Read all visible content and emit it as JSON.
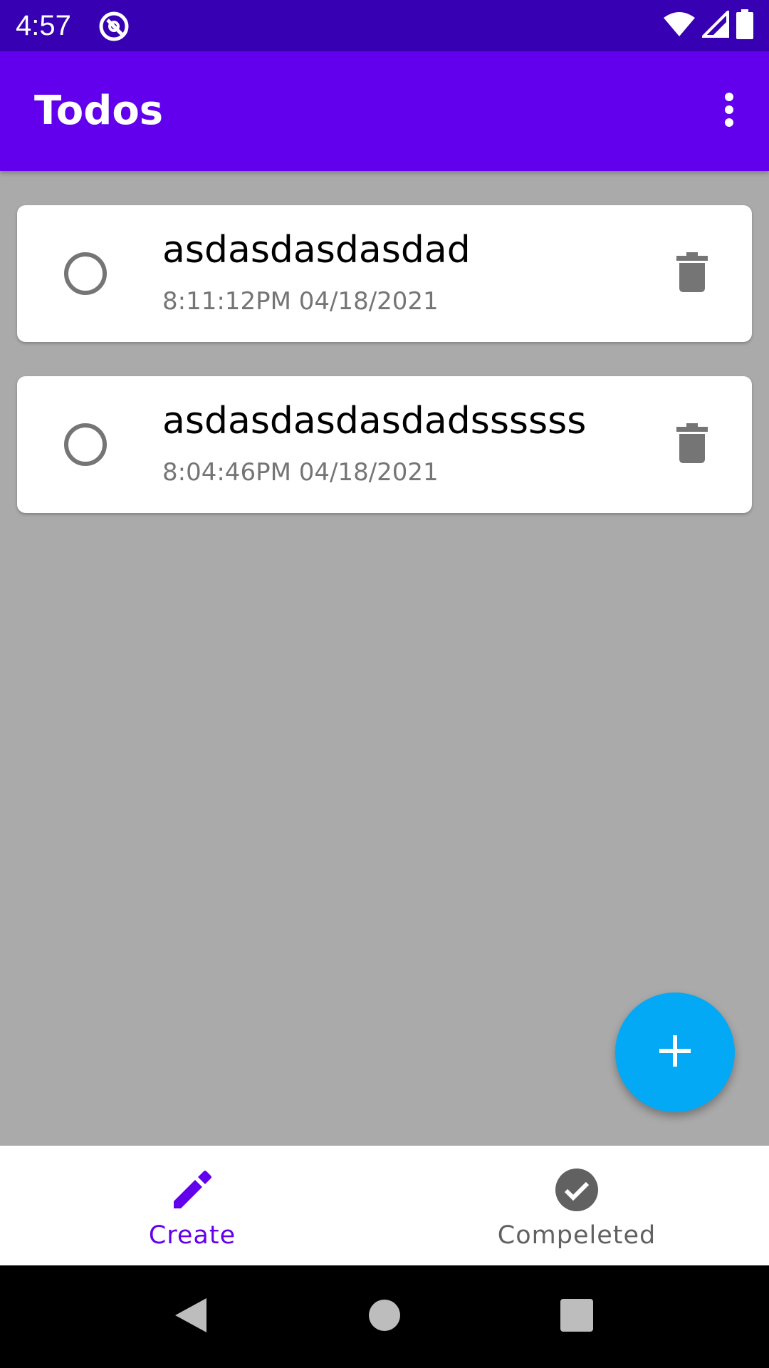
{
  "status_bar": {
    "time": "4:57",
    "icons": [
      "app-notification-icon",
      "wifi-icon",
      "cell-signal-icon",
      "battery-icon"
    ]
  },
  "app_bar": {
    "title": "Todos",
    "menu_icon": "more-vert-icon"
  },
  "todos": [
    {
      "title": "asdasdasdasdad",
      "timestamp": "8:11:12PM 04/18/2021",
      "checked": false
    },
    {
      "title": "asdasdasdasdadssssss",
      "timestamp": "8:04:46PM 04/18/2021",
      "checked": false
    }
  ],
  "fab": {
    "icon": "add-icon"
  },
  "bottom_nav": {
    "items": [
      {
        "label": "Create",
        "icon": "edit-icon",
        "active": true
      },
      {
        "label": "Compeleted",
        "icon": "check-circle-icon",
        "active": false
      }
    ]
  },
  "system_nav": {
    "buttons": [
      "back-icon",
      "home-icon",
      "recents-icon"
    ]
  },
  "colors": {
    "status_bar": "#3700b3",
    "primary": "#6200ee",
    "fab": "#03a9f4",
    "background": "#aaaaaa"
  }
}
